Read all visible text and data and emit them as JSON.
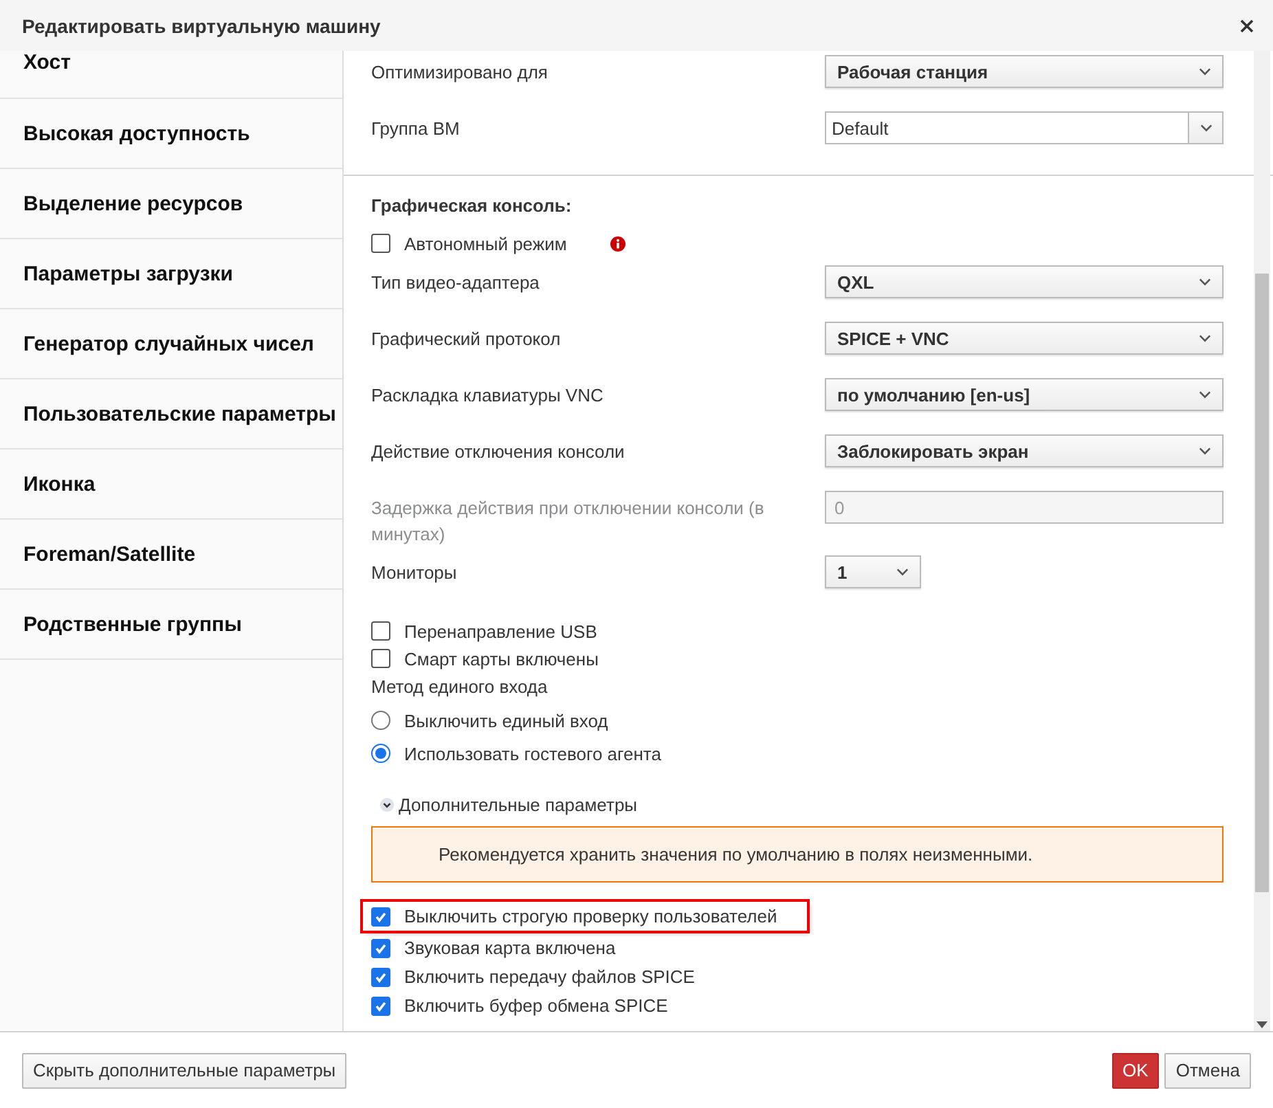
{
  "dialog": {
    "title": "Редактировать виртуальную машину"
  },
  "sidebar": {
    "items": [
      {
        "label": "Хост"
      },
      {
        "label": "Высокая доступность"
      },
      {
        "label": "Выделение ресурсов"
      },
      {
        "label": "Параметры загрузки"
      },
      {
        "label": "Генератор случайных чисел"
      },
      {
        "label": "Пользовательские параметры"
      },
      {
        "label": "Иконка"
      },
      {
        "label": "Foreman/Satellite"
      },
      {
        "label": "Родственные группы"
      }
    ]
  },
  "general_fields": [
    {
      "kind": "select",
      "label": "Оптимизировано для",
      "value": "Рабочая станция"
    },
    {
      "kind": "combo",
      "label": "Группа ВМ",
      "value": "Default"
    }
  ],
  "console": {
    "title": "Графическая консоль:",
    "items": [
      {
        "kind": "checkbox",
        "label": "Автономный режим",
        "checked": false,
        "info": true
      },
      {
        "kind": "select",
        "label": "Тип видео-адаптера",
        "value": "QXL"
      },
      {
        "kind": "select",
        "label": "Графический протокол",
        "value": "SPICE + VNC"
      },
      {
        "kind": "select",
        "label": "Раскладка клавиатуры VNC",
        "value": "по умолчанию [en-us]"
      },
      {
        "kind": "select",
        "label": "Действие отключения консоли",
        "value": "Заблокировать экран"
      },
      {
        "kind": "text",
        "label": "Задержка действия при отключении консоли (в минутах)",
        "value": "0",
        "disabled": true
      },
      {
        "kind": "small-select",
        "label": "Мониторы",
        "value": "1"
      },
      {
        "kind": "checkbox",
        "label": "Перенаправление USB",
        "checked": false,
        "info": false
      },
      {
        "kind": "checkbox",
        "label": "Смарт карты включены",
        "checked": false,
        "info": false
      },
      {
        "kind": "heading",
        "label": "Метод единого входа"
      },
      {
        "kind": "radio",
        "label": "Выключить единый вход",
        "selected": false
      },
      {
        "kind": "radio",
        "label": "Использовать гостевого агента",
        "selected": true
      }
    ]
  },
  "advanced": {
    "label": "Дополнительные параметры",
    "expanded": true,
    "notice": "Рекомендуется хранить значения по умолчанию в полях неизменными.",
    "checkboxes": [
      {
        "label": "Выключить строгую проверку пользователей",
        "checked": true,
        "highlighted": true
      },
      {
        "label": "Звуковая карта включена",
        "checked": true,
        "highlighted": false
      },
      {
        "label": "Включить передачу файлов SPICE",
        "checked": true,
        "highlighted": false
      },
      {
        "label": "Включить буфер обмена SPICE",
        "checked": true,
        "highlighted": false
      }
    ]
  },
  "footer": {
    "left_button": "Скрыть дополнительные параметры",
    "buttons": [
      {
        "label": "OK",
        "kind": "primary"
      },
      {
        "label": "Отмена",
        "kind": "default"
      }
    ]
  }
}
